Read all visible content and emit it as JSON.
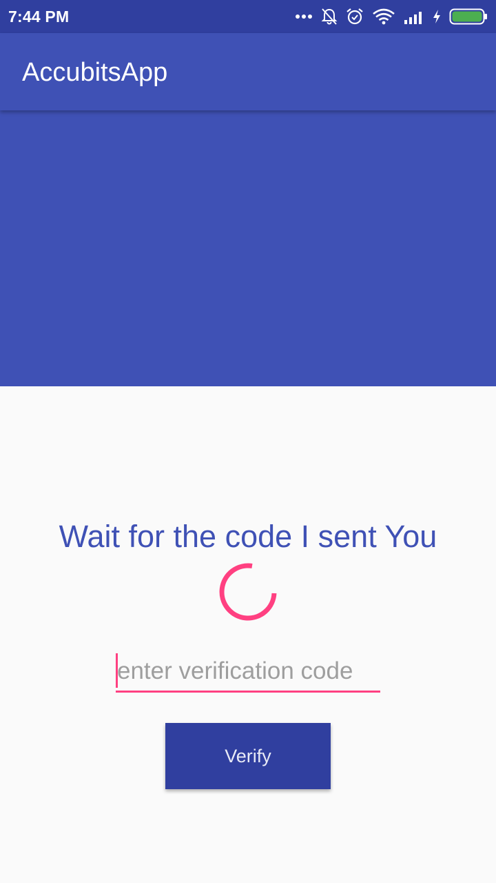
{
  "status_bar": {
    "time": "7:44 PM",
    "icons": [
      "more-dots-icon",
      "notifications-off-icon",
      "alarm-icon",
      "wifi-icon",
      "signal-icon",
      "charging-icon",
      "battery-icon"
    ]
  },
  "app_bar": {
    "title": "AccubitsApp"
  },
  "main": {
    "wait_message": "Wait for the code I sent You",
    "code_input": {
      "placeholder": "enter verification code",
      "value": ""
    },
    "verify_label": "Verify"
  },
  "colors": {
    "primary": "#3f51b5",
    "primary_dark": "#303f9f",
    "accent": "#ff4081",
    "battery": "#4caf50",
    "background": "#fafafa"
  }
}
